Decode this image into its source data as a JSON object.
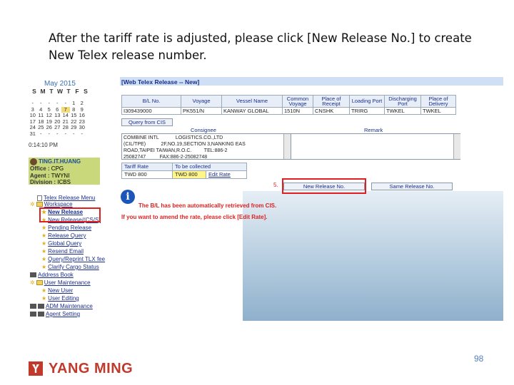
{
  "caption": "After the tariff rate is adjusted, please click [New Release No.] to create New Telex release number.",
  "calendar": {
    "title": "May 2015",
    "weekdays": [
      "S",
      "M",
      "T",
      "W",
      "T",
      "F",
      "S"
    ],
    "rows": [
      [
        "-",
        "-",
        "-",
        "-",
        "-",
        "1",
        "2"
      ],
      [
        "3",
        "4",
        "5",
        "6",
        "7",
        "8",
        "9"
      ],
      [
        "10",
        "11",
        "12",
        "13",
        "14",
        "15",
        "16"
      ],
      [
        "17",
        "18",
        "19",
        "20",
        "21",
        "22",
        "23"
      ],
      [
        "24",
        "25",
        "26",
        "27",
        "28",
        "29",
        "30"
      ],
      [
        "31",
        "-",
        "-",
        "-",
        "-",
        "-",
        "-"
      ]
    ],
    "highlight": "7"
  },
  "clock": "0:14:10 PM",
  "user": {
    "name": "TING.IT.HUANG",
    "office_label": "Office :",
    "office": "CPG",
    "agent_label": "Agent :",
    "agent": "TWYNI",
    "division_label": "Division :",
    "division": "ICBS"
  },
  "menu": {
    "items": [
      {
        "label": "Telex Release Menu"
      },
      {
        "label": "Workspace"
      },
      {
        "label": "New Release"
      },
      {
        "label": "New Release/(CS/S)"
      },
      {
        "label": "Pending Release"
      },
      {
        "label": "Release Query"
      },
      {
        "label": "Global Query"
      },
      {
        "label": "Resend Email"
      },
      {
        "label": "Query/Reprint TLX fee"
      },
      {
        "label": "Clarify Cargo Status"
      },
      {
        "label": "Address Book"
      },
      {
        "label": "User Maintenance"
      },
      {
        "label": "New User"
      },
      {
        "label": "User Editing"
      },
      {
        "label": "ADM Maintenance"
      },
      {
        "label": "Agent Setting"
      }
    ]
  },
  "form": {
    "title": "[Web Telex Release -- New]",
    "headers": [
      "B/L No.",
      "Voyage",
      "Vessel Name",
      "Common Voyage",
      "Place of Receipt",
      "Loading Port",
      "Discharging Port",
      "Place of Delivery"
    ],
    "row": [
      "I309439000",
      "PK551/N",
      "KANWAY GLOBAL",
      "1510N",
      "CNSHK",
      "TRIRG",
      "TWKEL",
      "TWKEL"
    ],
    "query_button": "Query from CIS",
    "consignee_label": "Consignee",
    "remark_label": "Remark",
    "consignee_text": "COMBINE INTL            LOGISTICS.CO.,LTD\n(CIL/TPE)           2F,NO.19,SECTION 3,NANKING EAS\nROAD,TAIPEI TAIWAN,R.O.C.         TEL:886-2\n25082747          FAX:886-2-25082748",
    "rate_headers": [
      "Tariff Rate",
      "To be collected"
    ],
    "tariff_rate": "TWD 800",
    "collected": "TWD 800",
    "edit_rate": "Edit Rate",
    "step": "5.",
    "new_release_button": "New Release No.",
    "same_release_button": "Same Release No.",
    "msg1": "The B/L has been automatically retrieved from CIS.",
    "msg2": "If you want to amend the rate, please click [Edit Rate]."
  },
  "footer": {
    "page_number": "98",
    "logo_text": "YANG MING"
  },
  "colors": {
    "highlight_red": "#e02020",
    "link_blue": "#1b2f8a",
    "user_box": "#c8d87a",
    "logo_red": "#c0392b"
  }
}
